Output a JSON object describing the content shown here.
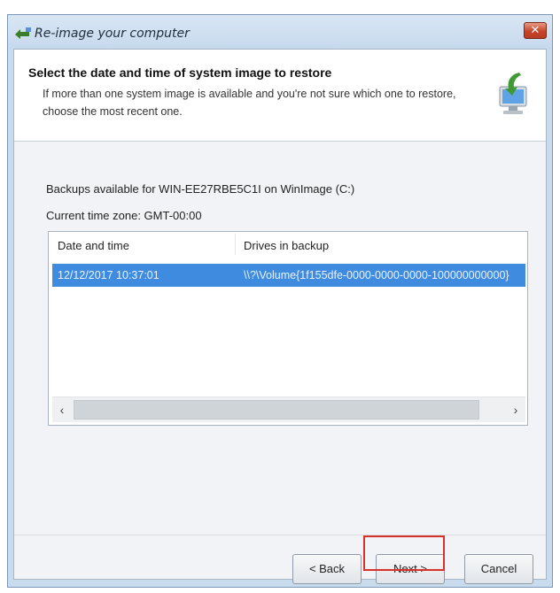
{
  "window": {
    "title": "Re-image your computer",
    "close_label": "✕"
  },
  "header": {
    "title": "Select the date and time of system image to restore",
    "subtitle": "If more than one system image is available and you're not sure which one to restore, choose the most recent one."
  },
  "info": {
    "backups_available": "Backups available for WIN-EE27RBE5C1I on WinImage (C:)",
    "timezone": "Current time zone: GMT-00:00"
  },
  "list": {
    "columns": [
      "Date and time",
      "Drives in backup"
    ],
    "rows": [
      {
        "date": "12/12/2017 10:37:01",
        "drives": "\\\\?\\Volume{1f155dfe-0000-0000-0000-100000000000}"
      }
    ],
    "scroll_left": "‹",
    "scroll_right": "›"
  },
  "buttons": {
    "back": "< Back",
    "next": "Next >",
    "cancel": "Cancel"
  },
  "colors": {
    "selection": "#3f8be0",
    "highlight_box": "#d9302a"
  }
}
